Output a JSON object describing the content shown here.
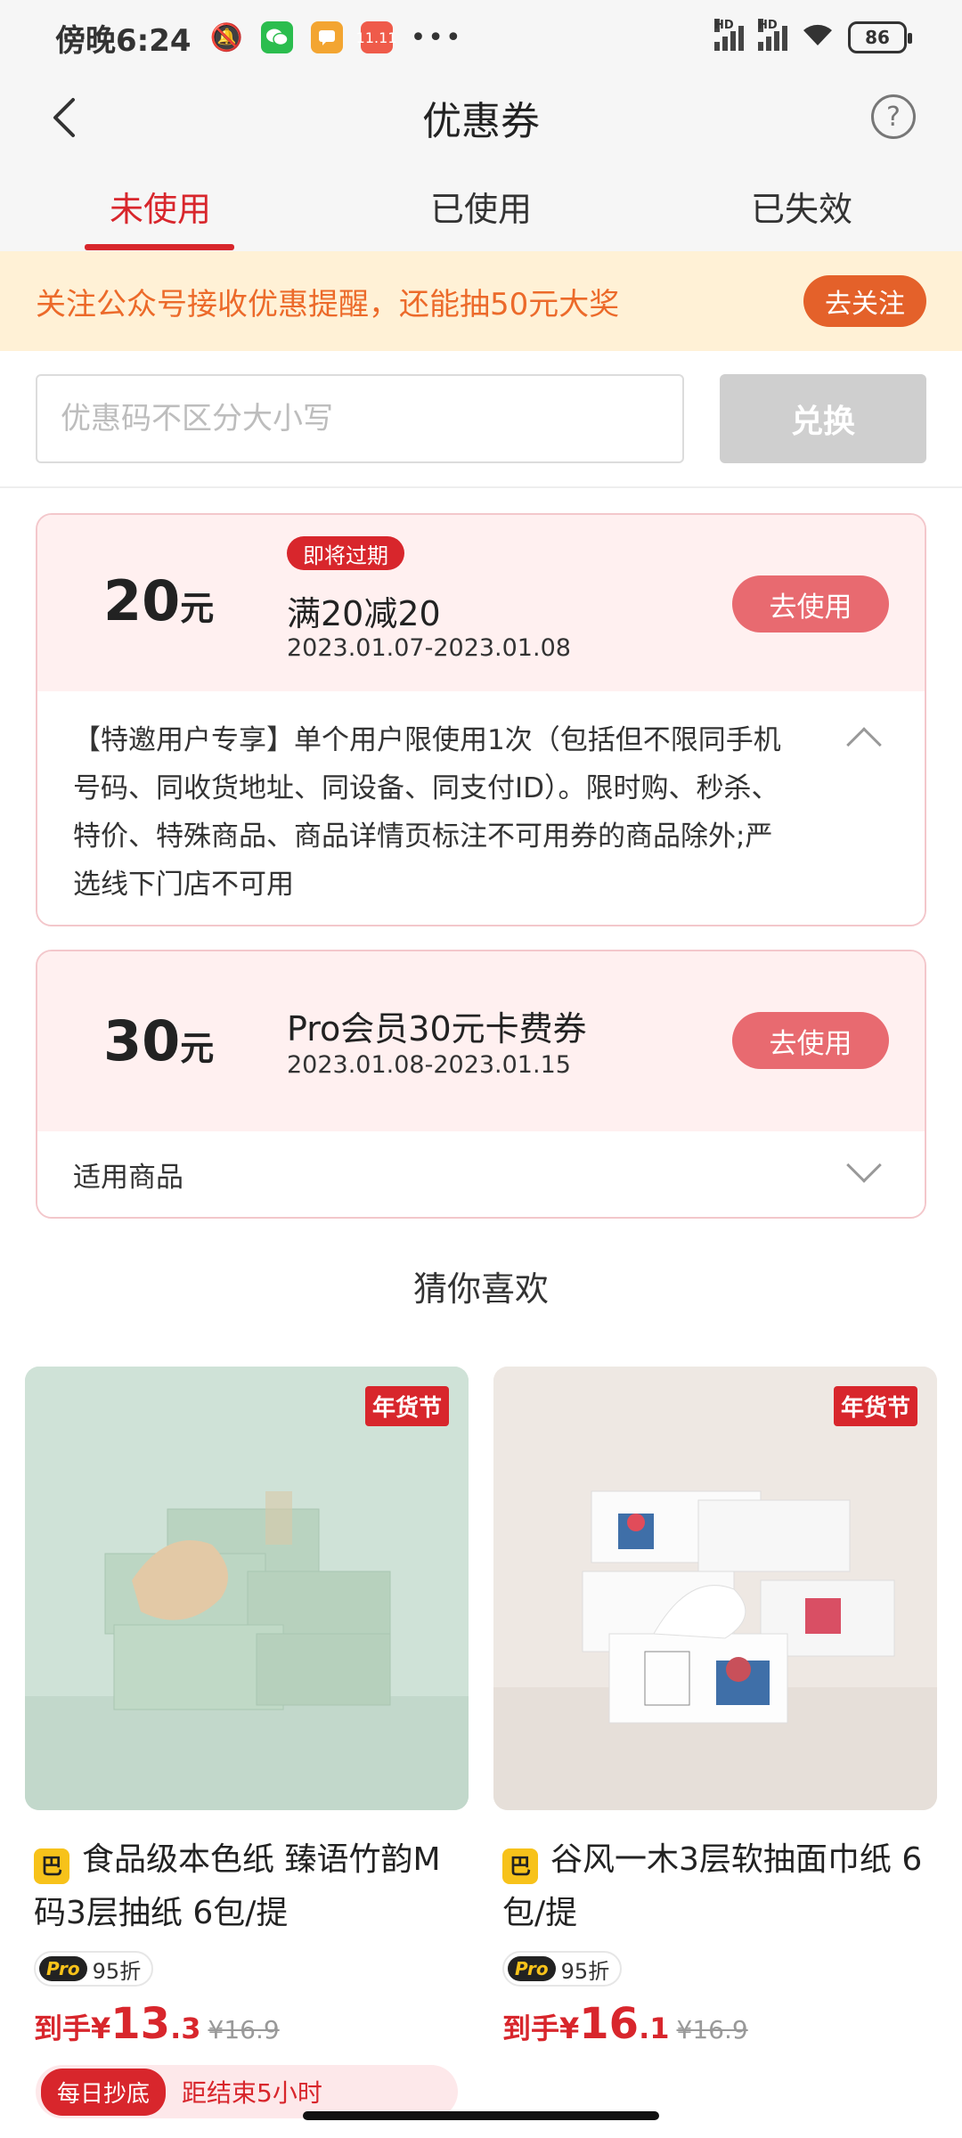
{
  "status_bar": {
    "time": "傍晚6:24",
    "network_label": "HD",
    "battery": "86",
    "app_icon_label": "11.11",
    "more": "•••"
  },
  "nav": {
    "title": "优惠券",
    "help": "?"
  },
  "tabs": [
    {
      "label": "未使用",
      "active": true
    },
    {
      "label": "已使用",
      "active": false
    },
    {
      "label": "已失效",
      "active": false
    }
  ],
  "banner": {
    "text": "关注公众号接收优惠提醒，还能抽50元大奖",
    "button": "去关注"
  },
  "redeem": {
    "placeholder": "优惠码不区分大小写",
    "value": "",
    "button": "兑换"
  },
  "coupons": [
    {
      "amount": "20",
      "unit": "元",
      "badge": "即将过期",
      "title": "满20减20",
      "date": "2023.01.07-2023.01.08",
      "button": "去使用",
      "description": "【特邀用户专享】单个用户限使用1次（包括但不限同手机号码、同收货地址、同设备、同支付ID）。限时购、秒杀、特价、特殊商品、商品详情页标注不可用券的商品除外;严选线下门店不可用",
      "expanded": true
    },
    {
      "amount": "30",
      "unit": "元",
      "title": "Pro会员30元卡费券",
      "date": "2023.01.08-2023.01.15",
      "button": "去使用",
      "footer": "适用商品",
      "expanded": false
    }
  ],
  "recommend": {
    "title": "猜你喜欢",
    "products": [
      {
        "tag": "年货节",
        "brand_icon": "巴",
        "name": "食品级本色纸 臻语竹韵M码3层抽纸 6包/提",
        "pro_badge": "Pro",
        "discount": "95折",
        "price_label": "到手¥",
        "price_int": "13",
        "price_dec": ".3",
        "original": "¥16.9"
      },
      {
        "tag": "年货节",
        "brand_icon": "巴",
        "name": "谷风一木3层软抽面巾纸 6包/提",
        "pro_badge": "Pro",
        "discount": "95折",
        "price_label": "到手¥",
        "price_int": "16",
        "price_dec": ".1",
        "original": "¥16.9"
      }
    ]
  },
  "promo": {
    "badge": "每日抄底",
    "text": "距结束5小时"
  },
  "colors": {
    "accent": "#d8262c",
    "banner_bg": "#fff1d6",
    "banner_text": "#ec6a2a",
    "coupon_bg": "#fff0f0",
    "use_button": "#e86a70"
  }
}
